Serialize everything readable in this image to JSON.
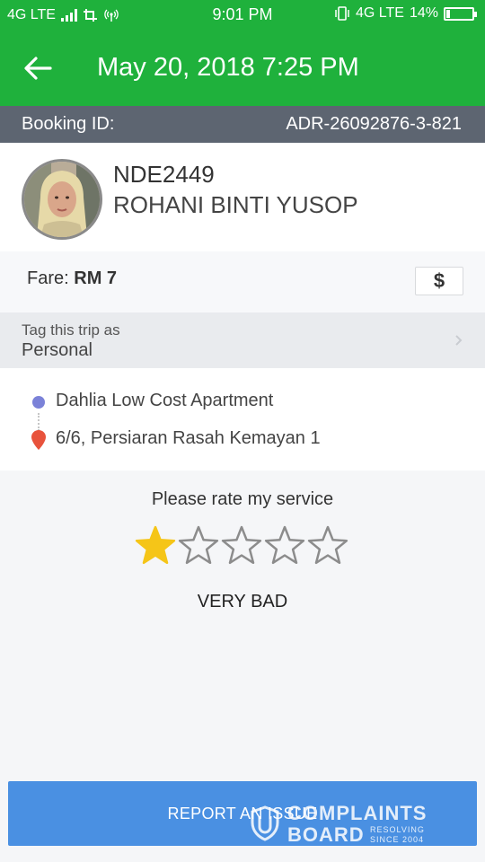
{
  "status_bar": {
    "network_left": "4G LTE",
    "time": "9:01 PM",
    "network_right": "4G LTE",
    "battery_percent": "14%",
    "battery_level": 0.14
  },
  "header": {
    "title": "May 20, 2018 7:25 PM",
    "back_icon": "arrow-left-icon"
  },
  "booking": {
    "label": "Booking ID:",
    "id": "ADR-26092876-3-821"
  },
  "driver": {
    "plate": "NDE2449",
    "name": "ROHANI BINTI YUSOP"
  },
  "fare": {
    "label": "Fare:",
    "amount": "RM 7",
    "icon_glyph": "$"
  },
  "trip_tag": {
    "label": "Tag this trip as",
    "value": "Personal"
  },
  "route": {
    "pickup": "Dahlia Low Cost Apartment",
    "destination": "6/6, Persiaran Rasah Kemayan 1"
  },
  "rating": {
    "prompt": "Please rate my service",
    "stars_selected": 1,
    "stars_total": 5,
    "verdict": "VERY BAD"
  },
  "actions": {
    "report_label": "REPORT AN ISSUE"
  },
  "watermark": {
    "line1": "COMPLAINTS",
    "line2": "BOARD",
    "tag1": "RESOLVING",
    "tag2": "SINCE 2004"
  },
  "colors": {
    "brand_green": "#1fb13c",
    "booking_bar": "#5d6571",
    "button_blue": "#4a90e2",
    "star_gold": "#f5c518",
    "star_outline": "#8c8c8c",
    "pickup_dot": "#7b82d8",
    "destination_pin": "#e8533c"
  }
}
